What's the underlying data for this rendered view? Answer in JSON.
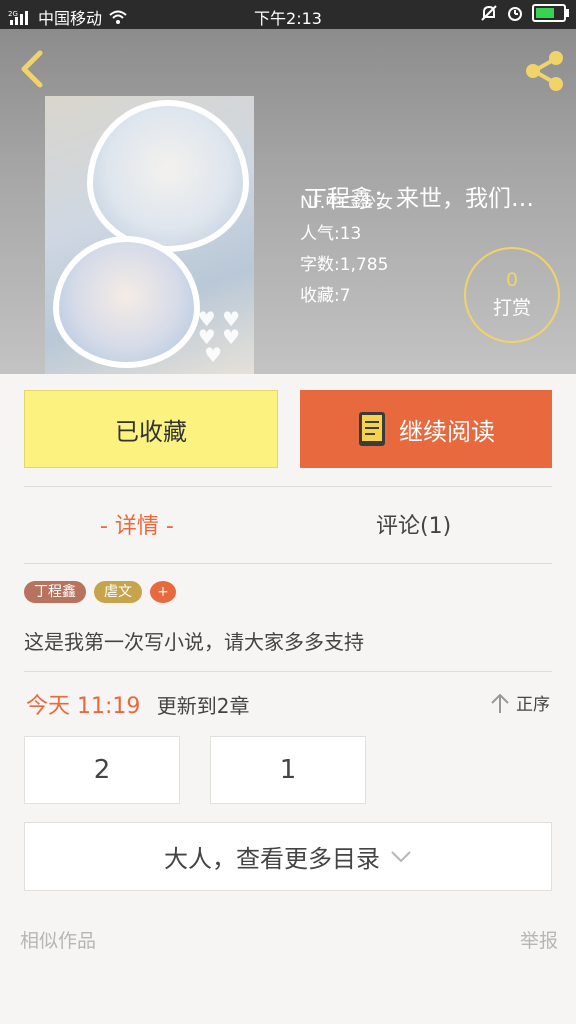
{
  "status_bar": {
    "carrier": "中国移动",
    "network": "2G",
    "time": "下午2:13"
  },
  "book": {
    "title": "丁程鑫：来世，我们…",
    "author_line": "NF.中二少女",
    "popularity": "人气:13",
    "word_count": "字数:1,785",
    "favorites": "收藏:7"
  },
  "reward": {
    "count": "0",
    "label": "打赏"
  },
  "actions": {
    "favorited_label": "已收藏",
    "continue_label": "继续阅读"
  },
  "tabs": {
    "detail": "- 详情 -",
    "comments": "评论(1)"
  },
  "tags": [
    "丁程鑫",
    "虐文",
    "+"
  ],
  "description": "这是我第一次写小说，请大家多多支持",
  "update": {
    "time": "今天 11:19",
    "text": "更新到2章",
    "sort_label": "正序"
  },
  "chapters": [
    "2",
    "1"
  ],
  "more_catalog_label": "大人，查看更多目录",
  "footer": {
    "similar": "相似作品",
    "report": "举报"
  },
  "colors": {
    "accent": "#e8693d",
    "fav_yellow": "#fcf27f",
    "reward_gold": "#f0d36a"
  }
}
